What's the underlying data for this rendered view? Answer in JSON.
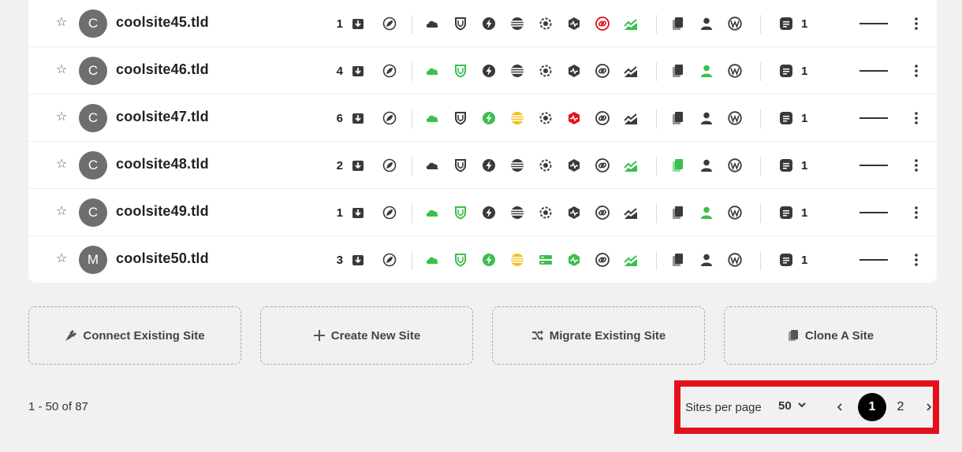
{
  "colors": {
    "accent_green": "#3bbf4c",
    "danger_red": "#e3111c",
    "warning_yellow": "#f2c21b",
    "icon_dark": "#3a3a3a"
  },
  "rows": [
    {
      "avatar": "C",
      "name": "coolsite45.tld",
      "updates": "1",
      "notes": "1",
      "status": {
        "cloud": "dark",
        "shield": "dark",
        "bolt": "dark",
        "stripes": "dark",
        "gear": "dark",
        "hex": "dark",
        "link": "red",
        "chart": "green",
        "clone": "dark",
        "user": "dark"
      }
    },
    {
      "avatar": "C",
      "name": "coolsite46.tld",
      "updates": "4",
      "notes": "1",
      "status": {
        "cloud": "green",
        "shield": "green",
        "bolt": "dark",
        "stripes": "dark",
        "gear": "dark",
        "hex": "dark",
        "link": "dark",
        "chart": "dark",
        "clone": "dark",
        "user": "green"
      }
    },
    {
      "avatar": "C",
      "name": "coolsite47.tld",
      "updates": "6",
      "notes": "1",
      "status": {
        "cloud": "green",
        "shield": "dark",
        "bolt": "green",
        "stripes": "yellow",
        "gear": "dark",
        "hex": "red",
        "link": "dark",
        "chart": "dark",
        "clone": "dark",
        "user": "dark"
      }
    },
    {
      "avatar": "C",
      "name": "coolsite48.tld",
      "updates": "2",
      "notes": "1",
      "status": {
        "cloud": "dark",
        "shield": "dark",
        "bolt": "dark",
        "stripes": "dark",
        "gear": "dark",
        "hex": "dark",
        "link": "dark",
        "chart": "green",
        "clone": "green",
        "user": "dark"
      }
    },
    {
      "avatar": "C",
      "name": "coolsite49.tld",
      "updates": "1",
      "notes": "1",
      "status": {
        "cloud": "green",
        "shield": "green",
        "bolt": "dark",
        "stripes": "dark",
        "gear": "dark",
        "hex": "dark",
        "link": "dark",
        "chart": "dark",
        "clone": "dark",
        "user": "green"
      }
    },
    {
      "avatar": "M",
      "name": "coolsite50.tld",
      "updates": "3",
      "notes": "1",
      "status": {
        "cloud": "green",
        "shield": "green",
        "bolt": "green",
        "stripes": "yellow",
        "gear": "server-green",
        "hex": "green",
        "link": "dark",
        "chart": "green",
        "clone": "dark",
        "user": "dark"
      }
    }
  ],
  "actions": {
    "connect": "Connect Existing Site",
    "create": "Create New Site",
    "migrate": "Migrate Existing Site",
    "clone": "Clone A Site"
  },
  "pagination": {
    "range_text": "1 - 50 of 87",
    "per_page_label": "Sites per page",
    "per_page_value": "50",
    "pages": [
      "1",
      "2"
    ],
    "current_page": "1",
    "prev_icon": "chevron-left-icon",
    "next_icon": "chevron-right-icon"
  }
}
